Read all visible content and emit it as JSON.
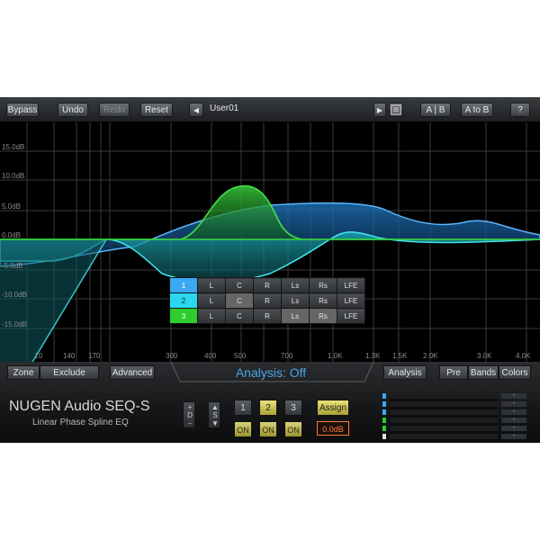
{
  "toolbar": {
    "bypass": "Bypass",
    "undo": "Undo",
    "redo": "Redo",
    "reset": "Reset",
    "prev": "◀",
    "preset": "User01",
    "next": "▶",
    "ab": "A | B",
    "a_to_b": "A to B",
    "help": "?"
  },
  "graph": {
    "db_labels": [
      "15.0dB",
      "10.0dB",
      "5.0dB",
      "0.0dB",
      "-5.0dB",
      "-10.0dB",
      "-15.0dB"
    ],
    "freq_labels": [
      "10",
      "140",
      "170",
      "300",
      "400",
      "500",
      "700",
      "1.0K",
      "1.3K",
      "1.5K",
      "2.0K",
      "3.0K",
      "4.0K"
    ]
  },
  "channels": [
    {
      "band": "1",
      "color": "#3aa8f2",
      "cols": [
        "L",
        "C",
        "R",
        "Ls",
        "Rs",
        "LFE"
      ]
    },
    {
      "band": "2",
      "color": "#29d8f0",
      "cols": [
        "L",
        "C",
        "R",
        "Ls",
        "Rs",
        "LFE"
      ]
    },
    {
      "band": "3",
      "color": "#2ecc2e",
      "cols": [
        "L",
        "C",
        "R",
        "Ls",
        "Rs",
        "LFE"
      ]
    }
  ],
  "bottom": {
    "zone": "Zone",
    "exclude": "Exclude",
    "advanced": "Advanced",
    "analysis_status": "Analysis: Off",
    "analysis": "Analysis",
    "pre": "Pre",
    "bands": "Bands",
    "colors": "Colors",
    "brand": "NUGEN Audio SEQ-S",
    "subtitle": "Linear Phase Spline EQ",
    "d_plus": "+",
    "d_label": "D",
    "d_minus": "–",
    "s_up": "▲",
    "s_label": "S",
    "s_down": "▼",
    "bands_list": [
      "1",
      "2",
      "3"
    ],
    "on_labels": [
      "ON",
      "ON",
      "ON"
    ],
    "assign": "Assign",
    "gain": "0.0dB",
    "meter_values": [
      "-",
      "-",
      "-",
      "-",
      "-",
      "-"
    ]
  }
}
